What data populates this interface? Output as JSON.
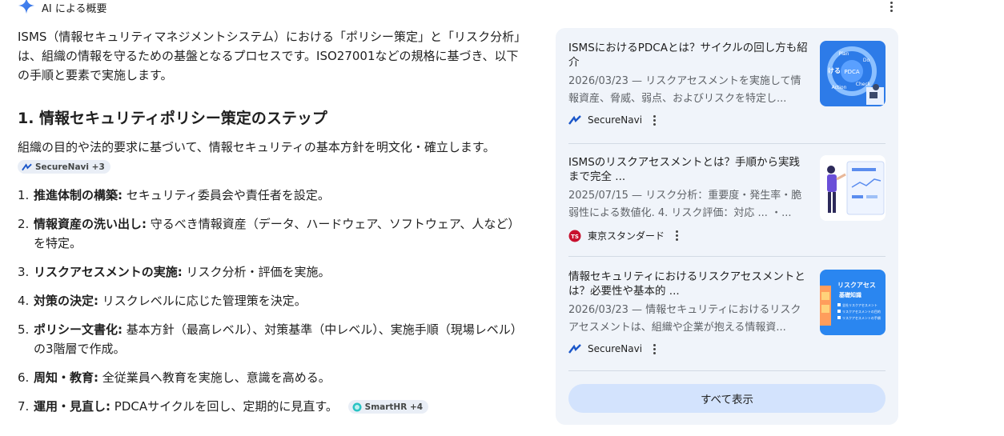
{
  "header": {
    "label": "AI による概要"
  },
  "intro": "ISMS（情報セキュリティマネジメントシステム）における「ポリシー策定」と「リスク分析」は、組織の情報を守るための基盤となるプロセスです。ISO27001などの規格に基づき、以下の手順と要素で実施します。",
  "section": {
    "title": "1. 情報セキュリティポリシー策定のステップ",
    "desc": "組織の目的や法的要求に基づいて、情報セキュリティの基本方針を明文化・確立します。",
    "desc_chip": "SecureNavi +3"
  },
  "steps": [
    {
      "num": "1.",
      "bold": "推進体制の構築:",
      "text": " セキュリティ委員会や責任者を設定。"
    },
    {
      "num": "2.",
      "bold": "情報資産の洗い出し:",
      "text": " 守るべき情報資産（データ、ハードウェア、ソフトウェア、人など）を特定。"
    },
    {
      "num": "3.",
      "bold": "リスクアセスメントの実施:",
      "text": " リスク分析・評価を実施。"
    },
    {
      "num": "4.",
      "bold": "対策の決定:",
      "text": " リスクレベルに応じた管理策を決定。"
    },
    {
      "num": "5.",
      "bold": "ポリシー文書化:",
      "text": " 基本方針（最高レベル）、対策基準（中レベル）、実施手順（現場レベル）の3階層で作成。"
    },
    {
      "num": "6.",
      "bold": "周知・教育:",
      "text": " 全従業員へ教育を実施し、意識を高める。"
    },
    {
      "num": "7.",
      "bold": "運用・見直し:",
      "text": " PDCAサイクルを回し、定期的に見直す。",
      "chip": "SmartHR +4"
    }
  ],
  "sources": [
    {
      "title": "ISMSにおけるPDCAとは？サイクルの回し方も紹介",
      "snippet": "2026/03/23 — リスクアセスメントを実施して情報資産、脅威、弱点、およびリスクを特定し...",
      "source": "SecureNavi",
      "thumb_text": [
        "Plan",
        "Do",
        "PDCA",
        "Action",
        "Check",
        "ける"
      ]
    },
    {
      "title": "ISMSのリスクアセスメントとは？手順から実践まで完全 ...",
      "snippet": "2025/07/15 — リスク分析：重要度・発生率・脆弱性による数値化. 4. リスク評価：対応 ... ・...",
      "source": "東京スタンダード",
      "source_logo": "TS"
    },
    {
      "title": "情報セキュリティにおけるリスクアセスメントとは？必要性や基本的 ...",
      "snippet": "2026/03/23 — 情報セキュリティにおけるリスクアセスメントは、組織や企業が抱える情報資...",
      "source": "SecureNavi",
      "thumb_text": [
        "リスクアセス",
        "基礎知識",
        "全社リスクアセスメント",
        "リスクアセスメントの目的",
        "リスクアセスメントの手順"
      ]
    }
  ],
  "show_all": "すべて表示",
  "colors": {
    "accent": "#4285f4",
    "panel": "#f0f4fa",
    "button": "#d3e3fd",
    "snippet": "#5f6368"
  }
}
